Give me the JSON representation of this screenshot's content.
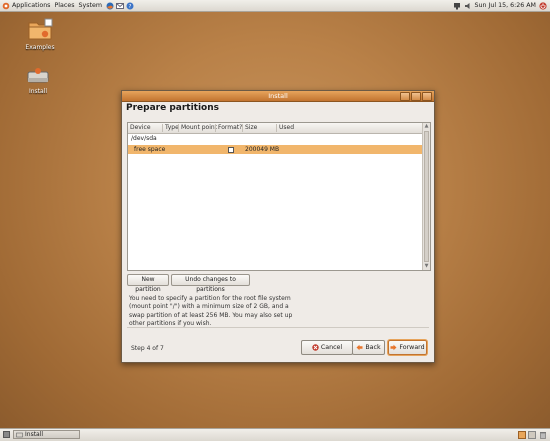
{
  "top_panel": {
    "menus": [
      "Applications",
      "Places",
      "System"
    ],
    "clock": "Sun Jul 15,  6:26 AM"
  },
  "desktop": {
    "icons": [
      {
        "label": "Examples",
        "icon": "folder-icon"
      },
      {
        "label": "Install",
        "icon": "drive-icon"
      }
    ]
  },
  "dialog": {
    "title": "Install",
    "heading": "Prepare partitions",
    "table": {
      "columns": [
        "Device",
        "Type",
        "Mount point",
        "Format?",
        "Size",
        "Used"
      ],
      "device": "/dev/sda",
      "rows": [
        {
          "device": "free space",
          "type": "",
          "mount": "",
          "format": false,
          "size": "200049 MB",
          "used": ""
        }
      ]
    },
    "buttons": {
      "new_partition": "New partition",
      "undo": "Undo changes to partitions"
    },
    "info": "You need to specify a partition for the root file system (mount point \"/\") with a minimum size of 2 GB, and a swap partition of at least 256 MB. You may also set up other partitions if you wish.",
    "step": "Step 4 of 7",
    "nav": {
      "cancel": "Cancel",
      "back": "Back",
      "forward": "Forward"
    }
  },
  "taskbar": {
    "task": "Install"
  },
  "colors": {
    "accent": "#e7a45c",
    "selection": "#f1b66c",
    "desktop": "#b98148"
  }
}
